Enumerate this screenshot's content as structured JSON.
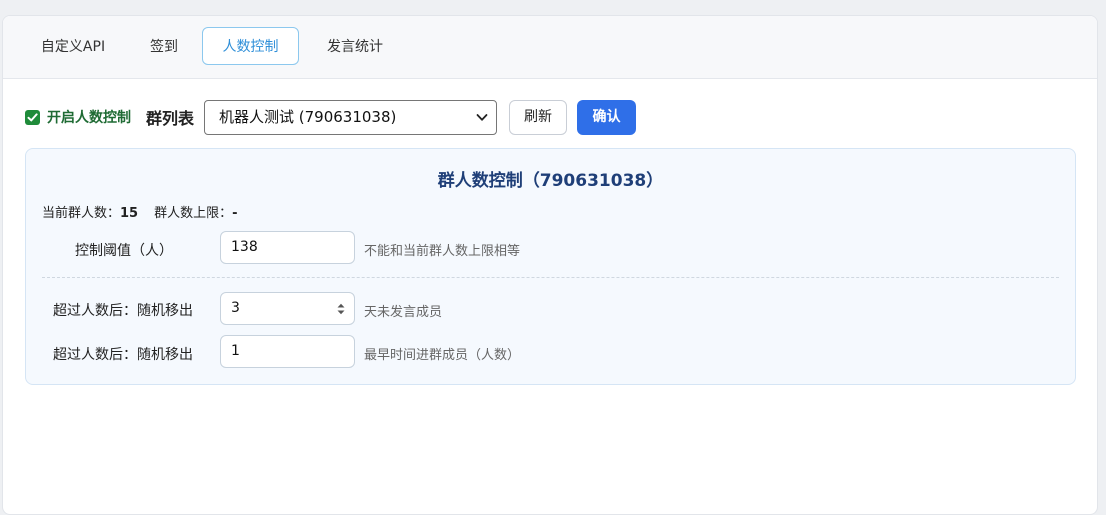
{
  "tabs": [
    {
      "label": "自定义API",
      "active": false
    },
    {
      "label": "签到",
      "active": false
    },
    {
      "label": "人数控制",
      "active": true
    },
    {
      "label": "发言统计",
      "active": false
    }
  ],
  "toolbar": {
    "enable_label": "开启人数控制",
    "enable_checked": true,
    "group_list_label": "群列表",
    "group_select_value": "机器人测试 (790631038)",
    "refresh_label": "刷新",
    "confirm_label": "确认"
  },
  "panel": {
    "title": "群人数控制（790631038）",
    "current_count_label": "当前群人数：",
    "current_count_value": "15",
    "limit_label": "群人数上限：",
    "limit_value": "-",
    "threshold_label": "控制阈值（人）",
    "threshold_value": "138",
    "threshold_hint": "不能和当前群人数上限相等",
    "remove_inactive_label": "超过人数后：随机移出",
    "remove_inactive_value": "3",
    "remove_inactive_hint": "天未发言成员",
    "remove_earliest_label": "超过人数后：随机移出",
    "remove_earliest_value": "1",
    "remove_earliest_hint": "最早时间进群成员（人数）"
  },
  "colors": {
    "accent": "#2f6fe8",
    "active_tab": "#2f8fd8",
    "checkbox": "#1f8b3a",
    "title": "#1f3f78"
  },
  "icons": {
    "checkbox": "check-icon",
    "select": "chevron-down-icon",
    "stepper": "spin-arrows-icon"
  }
}
